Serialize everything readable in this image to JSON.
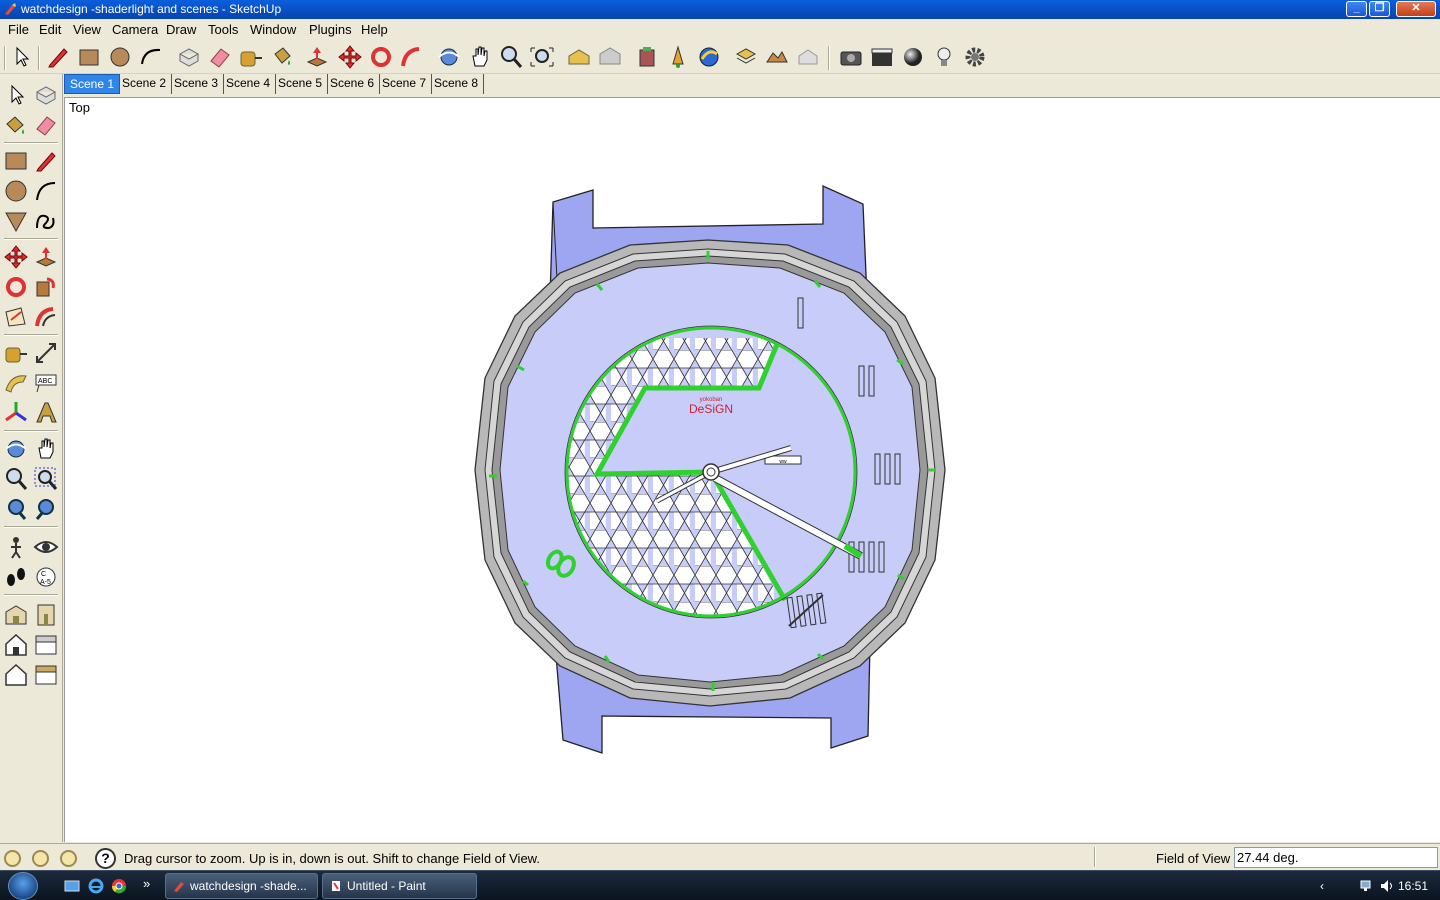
{
  "window": {
    "title": "watchdesign -shaderlight and scenes - SketchUp",
    "min_label": "_",
    "max_label": "❐",
    "close_label": "✕"
  },
  "menu": [
    "File",
    "Edit",
    "View",
    "Camera",
    "Draw",
    "Tools",
    "Window",
    "Plugins",
    "Help"
  ],
  "toolbar_icons": [
    "select-icon",
    "pencil-icon",
    "rectangle-icon",
    "circle-icon",
    "arc-icon",
    "make-component-icon",
    "eraser-icon",
    "tape-measure-icon",
    "paint-bucket-icon",
    "push-pull-icon",
    "move-icon",
    "rotate-icon",
    "follow-me-icon",
    "orbit-icon",
    "pan-icon",
    "zoom-icon",
    "zoom-extents-icon",
    "get-models-icon",
    "share-model-icon",
    "component-warehouse-icon",
    "place-model-icon",
    "google-earth-icon",
    "get-current-view-icon",
    "toggle-terrain-icon",
    "share-component-icon",
    "camera-icon",
    "clapperboard-icon",
    "sphere-icon",
    "light-bulb-icon",
    "settings-icon"
  ],
  "scenes": {
    "tabs": [
      "Scene 1",
      "Scene 2",
      "Scene 3",
      "Scene 4",
      "Scene 5",
      "Scene 6",
      "Scene 7",
      "Scene 8"
    ],
    "active": "Scene 1"
  },
  "left_tools": [
    "select-icon",
    "make-component-icon",
    "paint-bucket-icon",
    "eraser-icon",
    "rectangle-icon",
    "line-icon",
    "circle-icon",
    "arc-icon",
    "polygon-icon",
    "freehand-icon",
    "move-icon",
    "push-pull-icon",
    "rotate-icon",
    "follow-me-icon",
    "scale-icon",
    "offset-icon",
    "tape-measure-icon",
    "dimension-icon",
    "protractor-icon",
    "text-icon",
    "axes-icon",
    "3d-text-icon",
    "orbit-icon",
    "pan-icon",
    "zoom-icon",
    "zoom-window-icon",
    "previous-view-icon",
    "next-view-icon",
    "position-camera-icon",
    "look-around-icon",
    "walk-icon",
    "section-plane-icon",
    "iso-view-icon",
    "front-view-icon",
    "top-view-icon",
    "right-view-icon",
    "back-view-icon",
    "left-view-icon"
  ],
  "viewport": {
    "view_name": "Top",
    "brand_small": "yokoban",
    "brand_large": "DeSiGN",
    "date_window": "ww"
  },
  "colors": {
    "case": "#9ea6f2",
    "dial": "#c8ccf8",
    "accent_green": "#2ed12e",
    "bezel": "#a8a8a8"
  },
  "status": {
    "message": "Drag cursor to zoom.  Up is in, down is out. Shift to change Field of View.",
    "vcb_label": "Field of View",
    "vcb_value": "27.44 deg."
  },
  "taskbar": {
    "buttons": [
      "watchdesign -shade...",
      "Untitled - Paint"
    ],
    "more": "»",
    "tray_arrow": "‹",
    "clock": "16:51"
  }
}
